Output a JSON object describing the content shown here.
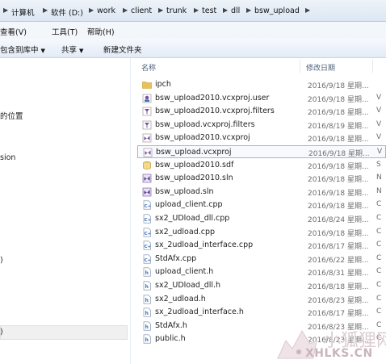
{
  "breadcrumb": [
    "计算机",
    "软件 (D:)",
    "work",
    "client",
    "trunk",
    "test",
    "dll",
    "bsw_upload"
  ],
  "menu": [
    "查看(V)",
    "工具(T)",
    "帮助(H)"
  ],
  "toolbar": {
    "include_label": "包含到库中",
    "share_label": "共享",
    "new_folder_label": "新建文件夹"
  },
  "nav": {
    "items": [
      "的位置",
      "sion",
      ")",
      ")"
    ]
  },
  "columns": {
    "name": "名称",
    "date": "修改日期"
  },
  "files": [
    {
      "name": "ipch",
      "date": "2016/9/18 星期...",
      "extra": "",
      "icon": "folder-icon"
    },
    {
      "name": "bsw_upload2010.vcxproj.user",
      "date": "2016/9/18 星期...",
      "extra": "V",
      "icon": "vs-user-file-icon"
    },
    {
      "name": "bsw_upload2010.vcxproj.filters",
      "date": "2016/9/18 星期...",
      "extra": "V",
      "icon": "vs-filters-file-icon"
    },
    {
      "name": "bsw_upload.vcxproj.filters",
      "date": "2016/8/19 星期...",
      "extra": "V",
      "icon": "vs-filters-file-icon"
    },
    {
      "name": "bsw_upload2010.vcxproj",
      "date": "2016/9/18 星期...",
      "extra": "V",
      "icon": "vs-project-file-icon"
    },
    {
      "name": "bsw_upload.vcxproj",
      "date": "2016/9/18 星期...",
      "extra": "V",
      "icon": "vs-project-file-icon"
    },
    {
      "name": "bsw_upload2010.sdf",
      "date": "2016/9/18 星期...",
      "extra": "S",
      "icon": "sdf-database-icon"
    },
    {
      "name": "bsw_upload2010.sln",
      "date": "2016/9/18 星期...",
      "extra": "N",
      "icon": "vs-solution-file-icon"
    },
    {
      "name": "bsw_upload.sln",
      "date": "2016/9/18 星期...",
      "extra": "N",
      "icon": "vs-solution-file-icon"
    },
    {
      "name": "upload_client.cpp",
      "date": "2016/9/18 星期...",
      "extra": "C",
      "icon": "cpp-file-icon"
    },
    {
      "name": "sx2_UDload_dll.cpp",
      "date": "2016/8/24 星期...",
      "extra": "C",
      "icon": "cpp-file-icon"
    },
    {
      "name": "sx2_udload.cpp",
      "date": "2016/9/18 星期...",
      "extra": "C",
      "icon": "cpp-file-icon"
    },
    {
      "name": "sx_2udload_interface.cpp",
      "date": "2016/8/17 星期...",
      "extra": "C",
      "icon": "cpp-file-icon"
    },
    {
      "name": "StdAfx.cpp",
      "date": "2016/6/22 星期...",
      "extra": "C",
      "icon": "cpp-file-icon"
    },
    {
      "name": "upload_client.h",
      "date": "2016/8/31 星期...",
      "extra": "C",
      "icon": "header-file-icon"
    },
    {
      "name": "sx2_UDload_dll.h",
      "date": "2016/8/18 星期...",
      "extra": "C",
      "icon": "header-file-icon"
    },
    {
      "name": "sx2_udload.h",
      "date": "2016/8/23 星期...",
      "extra": "C",
      "icon": "header-file-icon"
    },
    {
      "name": "sx_2udload_interface.h",
      "date": "2016/8/17 星期...",
      "extra": "C",
      "icon": "header-file-icon"
    },
    {
      "name": "StdAfx.h",
      "date": "2016/8/23 星期...",
      "extra": "C",
      "icon": "header-file-icon"
    },
    {
      "name": "public.h",
      "date": "2016/8/23 星期...",
      "extra": "C",
      "icon": "header-file-icon"
    }
  ],
  "selected_index": 5,
  "watermark": {
    "cn": "小狐狸网",
    "url": "XHLKS.CN"
  },
  "colors": {
    "folder": "#e8c15a",
    "vs_purple": "#7b4fa6",
    "cpp_blue": "#3d6fb6",
    "selection_border": "#9eb6d6"
  }
}
